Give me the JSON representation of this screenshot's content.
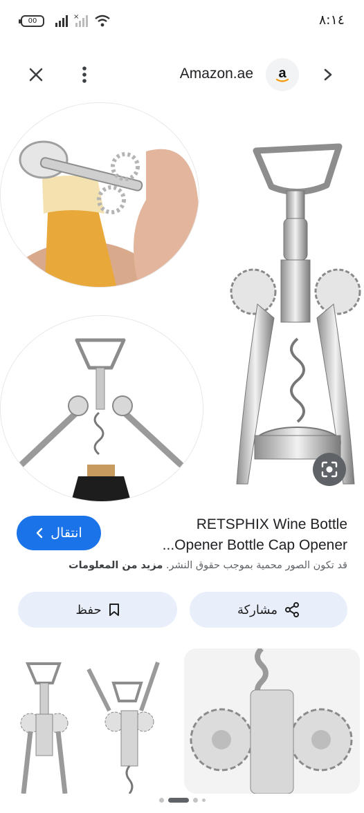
{
  "status_bar": {
    "time": "٨:١٤",
    "battery": "00"
  },
  "header": {
    "source_name": "Amazon.ae"
  },
  "result": {
    "title_line1": "RETSPHIX Wine Bottle",
    "title_line2": "...Opener Bottle Cap Opener",
    "visit_label": "انتقال",
    "notice_text": "قد تكون الصور محمية بموجب حقوق النشر.",
    "notice_link": "مزيد من المعلومات",
    "share_label": "مشاركة",
    "save_label": "حفظ"
  },
  "pager": {
    "count": 4,
    "active": 1
  },
  "colors": {
    "accent": "#1a73e8",
    "pill_bg": "#e8effa",
    "text": "#202124",
    "muted": "#5f6368"
  },
  "icons": [
    "close-icon",
    "more-vert-icon",
    "amazon-logo",
    "chevron-right-icon",
    "lens-icon",
    "share-icon",
    "bookmark-icon",
    "chevron-left-icon"
  ]
}
